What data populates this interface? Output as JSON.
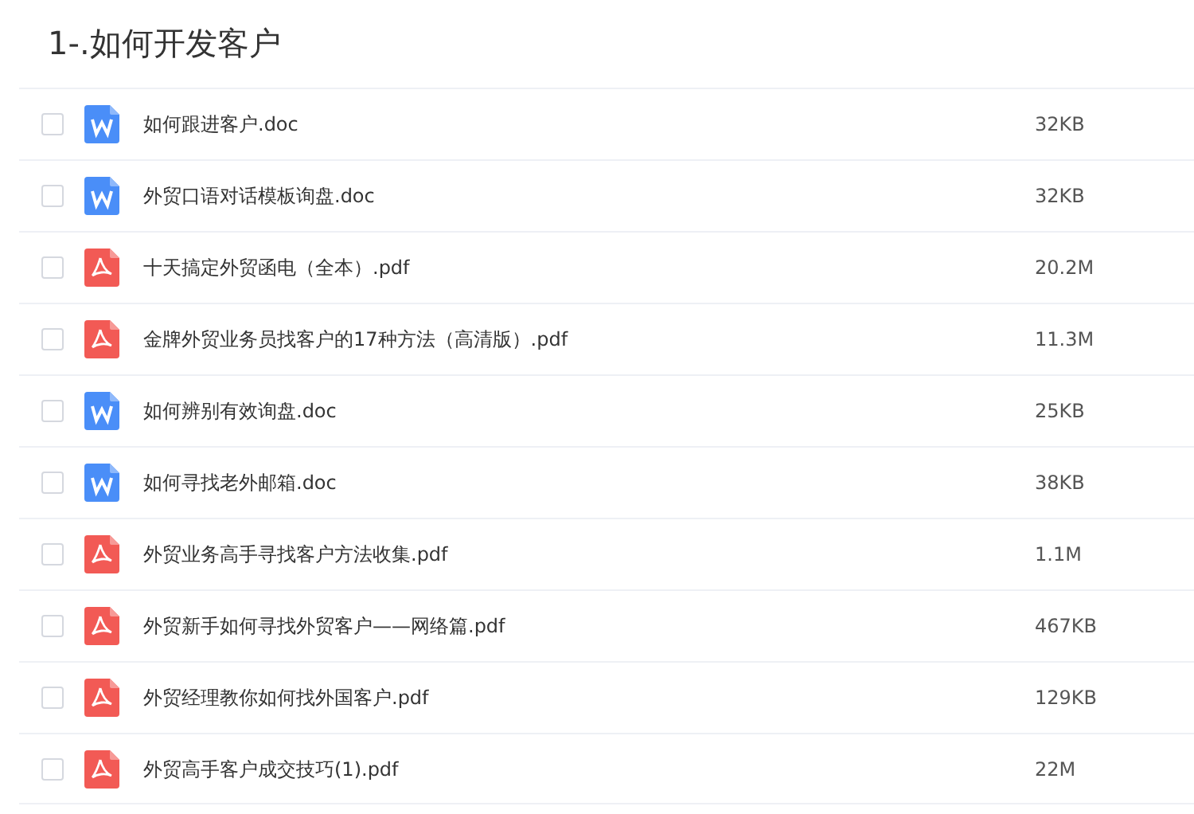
{
  "title": "1-.如何开发客户",
  "files": [
    {
      "name": "如何跟进客户.doc",
      "size": "32KB",
      "kind": "doc",
      "checked": false
    },
    {
      "name": "外贸口语对话模板询盘.doc",
      "size": "32KB",
      "kind": "doc",
      "checked": false
    },
    {
      "name": "十天搞定外贸函电（全本）.pdf",
      "size": "20.2M",
      "kind": "pdf",
      "checked": false
    },
    {
      "name": "金牌外贸业务员找客户的17种方法（高清版）.pdf",
      "size": "11.3M",
      "kind": "pdf",
      "checked": false
    },
    {
      "name": "如何辨别有效询盘.doc",
      "size": "25KB",
      "kind": "doc",
      "checked": false
    },
    {
      "name": "如何寻找老外邮箱.doc",
      "size": "38KB",
      "kind": "doc",
      "checked": false
    },
    {
      "name": "外贸业务高手寻找客户方法收集.pdf",
      "size": "1.1M",
      "kind": "pdf",
      "checked": false
    },
    {
      "name": "外贸新手如何寻找外贸客户——网络篇.pdf",
      "size": "467KB",
      "kind": "pdf",
      "checked": false
    },
    {
      "name": "外贸经理教你如何找外国客户.pdf",
      "size": "129KB",
      "kind": "pdf",
      "checked": false
    },
    {
      "name": "外贸高手客户成交技巧(1).pdf",
      "size": "22M",
      "kind": "pdf",
      "checked": false
    }
  ]
}
